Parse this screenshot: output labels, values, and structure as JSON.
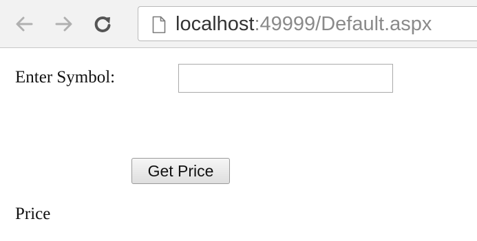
{
  "browser": {
    "url_host": "localhost",
    "url_path": ":49999/Default.aspx",
    "icons": {
      "back": "arrow-left",
      "forward": "arrow-right",
      "reload": "reload",
      "page": "document"
    },
    "colors": {
      "toolbar_background": "#f2f2f2",
      "nav_icon_disabled": "#b0b0b0",
      "reload_icon": "#555555",
      "url_host": "#333333",
      "url_path": "#8a8a8a"
    }
  },
  "form": {
    "symbol_label": "Enter Symbol:",
    "symbol_value": "",
    "get_price_label": "Get Price",
    "price_label": "Price"
  }
}
